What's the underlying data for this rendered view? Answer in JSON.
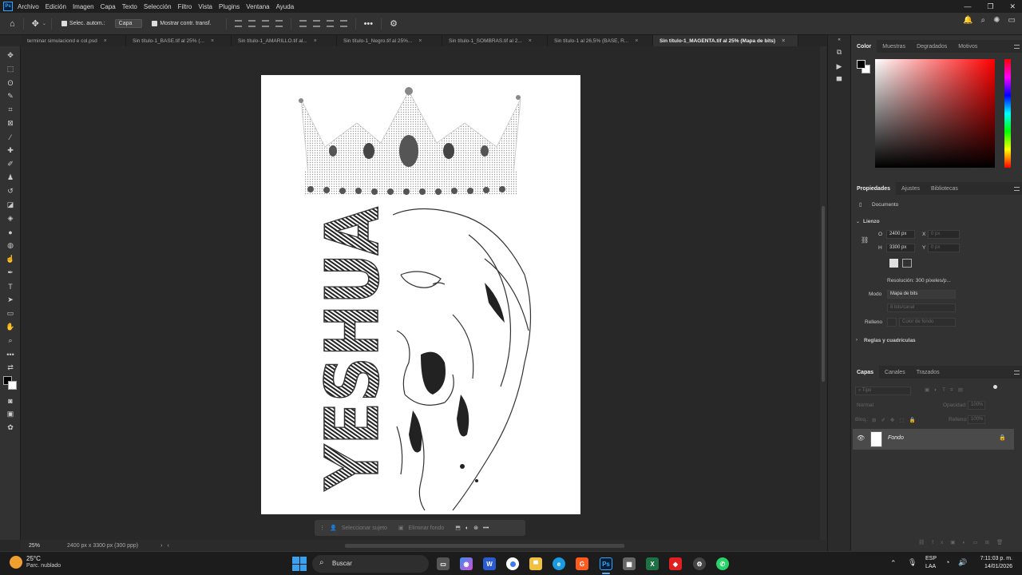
{
  "menu": {
    "app_badge": "Ps",
    "items": [
      "Archivo",
      "Edición",
      "Imagen",
      "Capa",
      "Texto",
      "Selección",
      "Filtro",
      "Vista",
      "Plugins",
      "Ventana",
      "Ayuda"
    ],
    "window_controls": [
      "—",
      "❐",
      "✕"
    ]
  },
  "options_bar": {
    "auto_select_label": "Selec. autom.:",
    "auto_select_target": "Capa",
    "show_transform_label": "Mostrar contr. transf."
  },
  "tabs": [
    {
      "label": "terminar simulaciond e col.psd",
      "active": false
    },
    {
      "label": "Sin título-1_BASE.tif al 25% (...",
      "active": false
    },
    {
      "label": "Sin título-1_AMARILLO.tif al...",
      "active": false
    },
    {
      "label": "Sin título-1_Negro.tif al 25%...",
      "active": false
    },
    {
      "label": "Sin título-1_SOMBRAS.tif al 2...",
      "active": false
    },
    {
      "label": "Sin título-1 al 26,5% (BASE, R...",
      "active": false
    },
    {
      "label": "Sin título-1_MAGENTA.tif al 25% (Mapa de bits)",
      "active": true
    }
  ],
  "tab_close_glyph": "×",
  "artwork": {
    "vertical_text": "YESHUA"
  },
  "context_bar": {
    "select_subject": "Seleccionar sujeto",
    "remove_background": "Eliminar fondo"
  },
  "status": {
    "zoom": "25%",
    "doc_info": "2400 px x 3300 px (300 ppp)"
  },
  "color_panel": {
    "tabs": [
      "Color",
      "Muestras",
      "Degradados",
      "Motivos"
    ],
    "active_tab": "Color"
  },
  "properties_panel": {
    "tabs": [
      "Propiedades",
      "Ajustes",
      "Bibliotecas"
    ],
    "active_tab": "Propiedades",
    "doc_label": "Documento",
    "section_canvas": "Lienzo",
    "width_label": "O",
    "width_value": "2400 px",
    "height_label": "H",
    "height_value": "3300 px",
    "x_label": "X",
    "x_placeholder": "0 px",
    "y_label": "Y",
    "y_placeholder": "0 px",
    "resolution": "Resolución: 300 píxeles/p...",
    "mode_label": "Modo",
    "mode_value": "Mapa de bits",
    "depth_value": "8 bits/canal",
    "fill_label": "Relleno",
    "fill_value": "Color de fondo",
    "section_rulers": "Reglas y cuadrículas"
  },
  "layers_panel": {
    "tabs": [
      "Capas",
      "Canales",
      "Trazados"
    ],
    "active_tab": "Capas",
    "filter_placeholder": "Tipo",
    "blend_mode": "Normal",
    "opacity_label": "Opacidad:",
    "opacity_value": "100%",
    "lock_label": "Bloq.:",
    "fill_label": "Relleno:",
    "fill_value": "100%",
    "layers": [
      {
        "name": "Fondo",
        "visible": true,
        "locked": true
      }
    ]
  },
  "taskbar": {
    "weather_temp": "25°C",
    "weather_desc": "Parc. nublado",
    "search_placeholder": "Buscar",
    "lang": "ESP",
    "lang_sub": "LAA",
    "time": "7:11:03 p. m.",
    "date": "14/01/2026"
  }
}
